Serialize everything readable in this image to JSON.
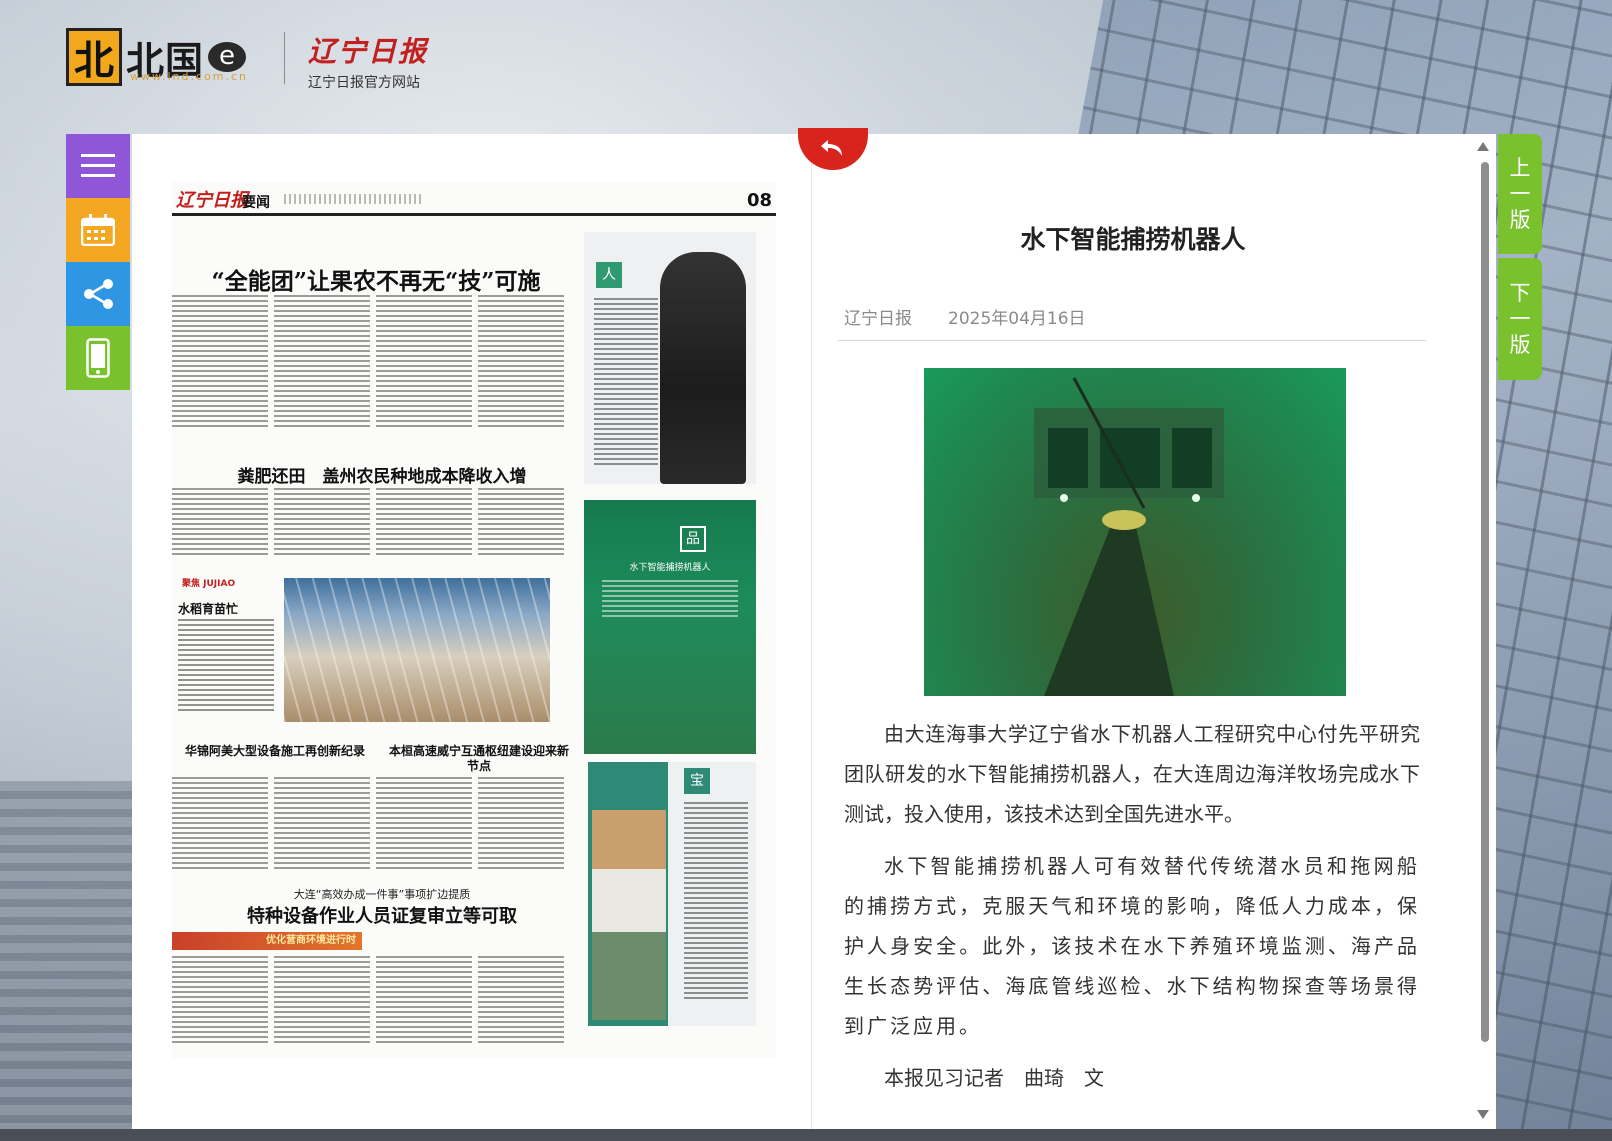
{
  "header": {
    "portal_logo_text": "北国",
    "portal_logo_e": "e",
    "portal_logo_mark": "北",
    "portal_url": "www.lnd.com.cn",
    "paper_logo": "辽宁日报",
    "paper_sub": "辽宁日报官方网站"
  },
  "toolbar": {
    "items": [
      {
        "name": "menu",
        "icon": "menu-icon",
        "color": "#8f57d8"
      },
      {
        "name": "calendar",
        "icon": "calendar-icon",
        "color": "#f3a722"
      },
      {
        "name": "share",
        "icon": "share-icon",
        "color": "#2e96e3"
      },
      {
        "name": "mobile",
        "icon": "mobile-phone-icon",
        "color": "#7ac12e"
      }
    ]
  },
  "newspaper": {
    "masthead": "辽宁日报",
    "section": "要闻",
    "page_no": "08",
    "headline1": "“全能团”让果农不再无“技”可施",
    "headline2": "粪肥还田　盖州农民种地成本降收入增",
    "juzhao": "聚焦 JUJIAO",
    "photo_caption_title": "水稻育苗忙",
    "headline3": "华锦阿美大型设备施工再创新纪录",
    "headline4": "本桓高速威宁互通枢纽建设迎来新节点",
    "kicker": "大连“高效办成一件事”事项扩边提质",
    "headline5": "特种设备作业人员证复审立等可取",
    "banner": "优化营商环境进行时",
    "side_badge1": "人",
    "side_badge2": "品",
    "side_badge3": "宝",
    "side2_title": "水下智能捕捞机器人"
  },
  "article": {
    "title": "水下智能捕捞机器人",
    "source": "辽宁日报",
    "date": "2025年04月16日",
    "paragraphs": [
      "由大连海事大学辽宁省水下机器人工程研究中心付先平研究团队研发的水下智能捕捞机器人，在大连周边海洋牧场完成水下测试，投入使用，该技术达到全国先进水平。",
      "水下智能捕捞机器人可有效替代传统潜水员和拖网船的捕捞方式，克服天气和环境的影响，降低人力成本，保护人身安全。此外，该技术在水下养殖环境监测、海产品生长态势评估、海底管线巡检、水下结构物探查等场景得到广泛应用。",
      "本报见习记者　曲琦　文"
    ]
  },
  "page_nav": {
    "prev_label": [
      "上",
      "一",
      "版"
    ],
    "next_label": [
      "下",
      "一",
      "版"
    ]
  },
  "colors": {
    "accent_green": "#7ac12e",
    "return_red": "#d9241e"
  }
}
